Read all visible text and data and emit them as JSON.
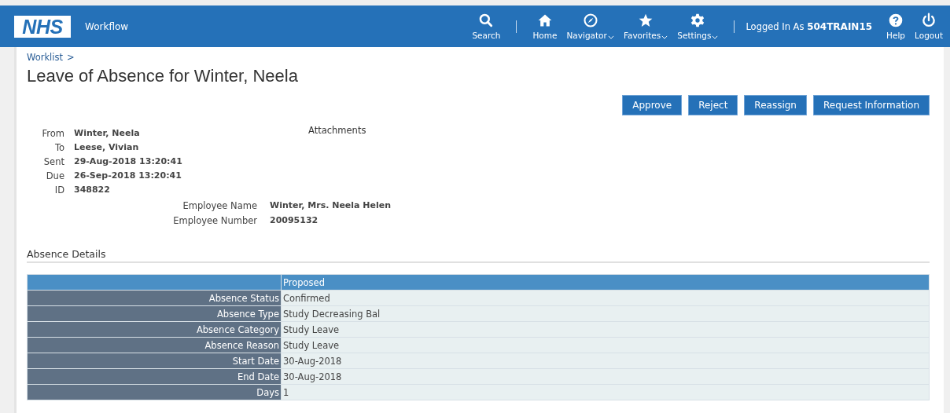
{
  "header": {
    "logo": "NHS",
    "app_title": "Workflow",
    "nav": [
      {
        "kind": "search",
        "label": "Search",
        "dropdown": false
      },
      {
        "kind": "separator"
      },
      {
        "kind": "home",
        "label": "Home",
        "dropdown": false
      },
      {
        "kind": "compass",
        "label": "Navigator",
        "dropdown": true
      },
      {
        "kind": "star",
        "label": "Favorites",
        "dropdown": true
      },
      {
        "kind": "gear",
        "label": "Settings",
        "dropdown": true
      },
      {
        "kind": "separator"
      },
      {
        "kind": "user",
        "prefix": "Logged In As",
        "username": "504TRAIN15"
      },
      {
        "kind": "help",
        "label": "Help",
        "dropdown": false
      },
      {
        "kind": "power",
        "label": "Logout",
        "dropdown": false
      }
    ]
  },
  "breadcrumb": "Worklist",
  "breadcrumb_separator": ">",
  "title": "Leave of Absence for Winter, Neela",
  "actions": [
    "Approve",
    "Reject",
    "Reassign",
    "Request Information"
  ],
  "details": [
    {
      "label": "From",
      "value": "Winter, Neela"
    },
    {
      "label": "To",
      "value": "Leese, Vivian"
    },
    {
      "label": "Sent",
      "value": "29-Aug-2018 13:20:41"
    },
    {
      "label": "Due",
      "value": "26-Sep-2018 13:20:41"
    },
    {
      "label": "ID",
      "value": "348822"
    }
  ],
  "attachments_label": "Attachments",
  "employee": [
    {
      "label": "Employee Name",
      "value": "Winter, Mrs. Neela Helen"
    },
    {
      "label": "Employee Number",
      "value": "20095132"
    }
  ],
  "section_title": "Absence Details",
  "table": {
    "columns": [
      "Proposed"
    ],
    "rows": [
      {
        "label": "Absence Status",
        "value": "Confirmed"
      },
      {
        "label": "Absence Type",
        "value": "Study Decreasing Bal"
      },
      {
        "label": "Absence Category",
        "value": "Study Leave"
      },
      {
        "label": "Absence Reason",
        "value": "Study Leave"
      },
      {
        "label": "Start Date",
        "value": "30-Aug-2018"
      },
      {
        "label": "End Date",
        "value": "30-Aug-2018"
      },
      {
        "label": "Days",
        "value": "1"
      }
    ]
  }
}
